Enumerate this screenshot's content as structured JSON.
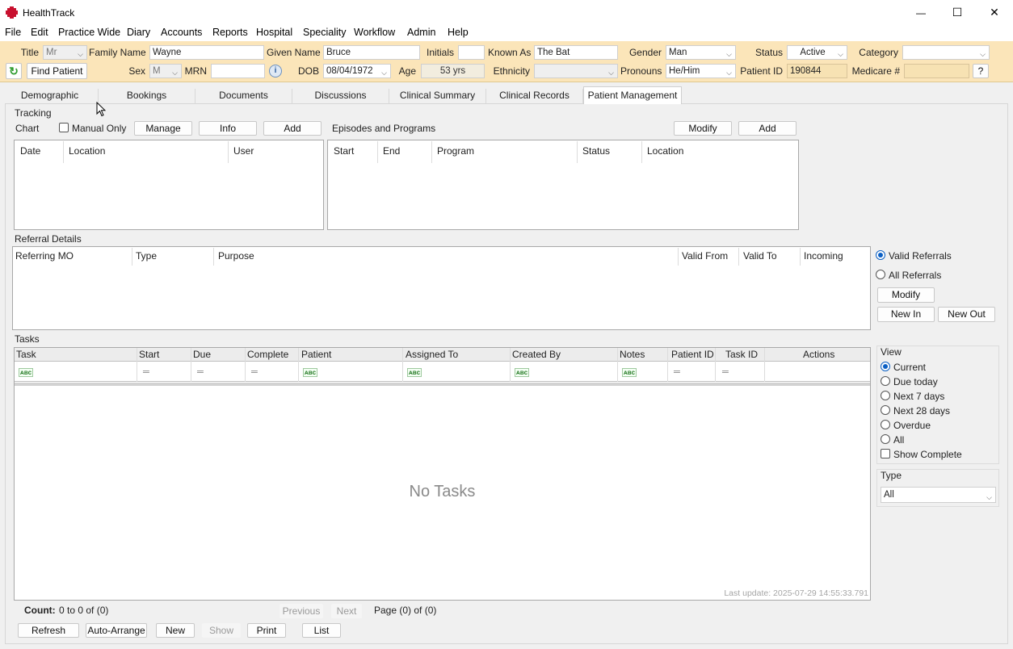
{
  "window": {
    "title": "HealthTrack",
    "controls": {
      "minimize": "—",
      "maximize": "☐",
      "close": "✕"
    }
  },
  "menu": [
    "File",
    "Edit",
    "Practice Wide",
    "Diary",
    "Accounts",
    "Reports",
    "Hospital",
    "Speciality",
    "Workflow",
    "Admin",
    "Help"
  ],
  "patient": {
    "title_label": "Title",
    "title_value": "Mr",
    "family_name_label": "Family Name",
    "family_name": "Wayne",
    "given_name_label": "Given Name",
    "given_name": "Bruce",
    "initials_label": "Initials",
    "initials": "",
    "known_as_label": "Known As",
    "known_as": "The Bat",
    "gender_label": "Gender",
    "gender": "Man",
    "status_label": "Status",
    "status": "Active",
    "category_label": "Category",
    "category": "",
    "find_patient_label": "Find Patient",
    "sex_label": "Sex",
    "sex": "M",
    "mrn_label": "MRN",
    "mrn": "",
    "dob_label": "DOB",
    "dob": "08/04/1972",
    "age_label": "Age",
    "age": "53 yrs",
    "ethnicity_label": "Ethnicity",
    "ethnicity": "",
    "pronouns_label": "Pronouns",
    "pronouns": "He/Him",
    "patient_id_label": "Patient ID",
    "patient_id": "190844",
    "medicare_label": "Medicare #",
    "medicare": "",
    "help_label": "?"
  },
  "tabs": [
    "Demographic",
    "Bookings",
    "Documents",
    "Discussions",
    "Clinical Summary",
    "Clinical Records",
    "Patient Management"
  ],
  "tracking": {
    "section_label": "Tracking",
    "chart_label": "Chart",
    "manual_only_label": "Manual Only",
    "manage_label": "Manage",
    "info_label": "Info",
    "add_label": "Add",
    "columns": [
      "Date",
      "Location",
      "User"
    ]
  },
  "episodes": {
    "section_label": "Episodes and Programs",
    "modify_label": "Modify",
    "add_label": "Add",
    "columns": [
      "Start",
      "End",
      "Program",
      "Status",
      "Location"
    ]
  },
  "referrals": {
    "section_label": "Referral Details",
    "columns": [
      "Referring MO",
      "Type",
      "Purpose",
      "Valid From",
      "Valid To",
      "Incoming"
    ],
    "valid_label": "Valid Referrals",
    "all_label": "All Referrals",
    "modify_label": "Modify",
    "new_in_label": "New In",
    "new_out_label": "New Out"
  },
  "tasks": {
    "section_label": "Tasks",
    "columns": [
      "Task",
      "Start",
      "Due",
      "Complete",
      "Patient",
      "Assigned To",
      "Created By",
      "Notes",
      "Patient ID",
      "Task ID",
      "Actions"
    ],
    "filter_text_icon": "ᴀʙc",
    "filter_eq_icon": "═",
    "empty_text": "No Tasks",
    "last_update": "Last update: 2025-07-29 14:55:33.791",
    "count_label": "Count:",
    "count_value": "0 to 0 of (0)",
    "previous_label": "Previous",
    "next_label": "Next",
    "page_text": "Page (0) of (0)",
    "buttons": {
      "refresh": "Refresh",
      "auto_arrange": "Auto-Arrange",
      "new": "New",
      "show": "Show",
      "print": "Print",
      "list": "List"
    }
  },
  "view": {
    "label": "View",
    "options": [
      "Current",
      "Due today",
      "Next 7 days",
      "Next 28 days",
      "Overdue",
      "All"
    ],
    "show_complete_label": "Show Complete",
    "type_label": "Type",
    "type_value": "All"
  },
  "colors": {
    "header_bg": "#fbe5b9",
    "accent": "#0a5fc4",
    "app_icon": "#c8102e"
  }
}
